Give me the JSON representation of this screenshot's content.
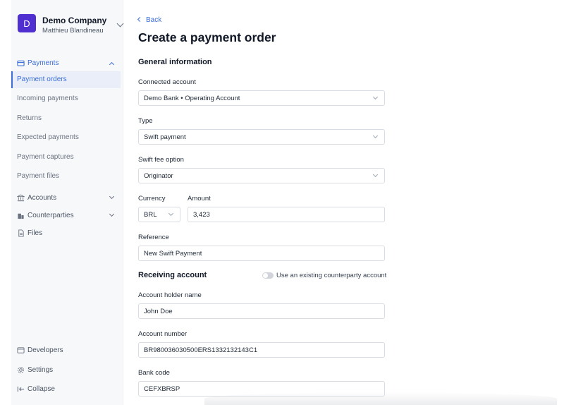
{
  "company": {
    "avatar_letter": "D",
    "name": "Demo Company",
    "user": "Matthieu Blandineau"
  },
  "sidebar": {
    "payments_group": "Payments",
    "payment_items": [
      "Payment orders",
      "Incoming payments",
      "Returns",
      "Expected payments",
      "Payment captures",
      "Payment files"
    ],
    "accounts": "Accounts",
    "counterparties": "Counterparties",
    "files": "Files",
    "developers": "Developers",
    "settings": "Settings",
    "collapse": "Collapse"
  },
  "main": {
    "back": "Back",
    "title": "Create a payment order",
    "general_section": "General information",
    "connected_account_label": "Connected account",
    "connected_account_value": "Demo Bank • Operating Account",
    "type_label": "Type",
    "type_value": "Swift payment",
    "swift_fee_label": "Swift fee option",
    "swift_fee_value": "Originator",
    "currency_label": "Currency",
    "currency_value": "BRL",
    "amount_label": "Amount",
    "amount_value": "3,423",
    "reference_label": "Reference",
    "reference_value": "New Swift Payment",
    "receiving_section": "Receiving account",
    "toggle_label": "Use an existing counterparty account",
    "toggle_on": false,
    "holder_label": "Account holder name",
    "holder_value": "John Doe",
    "account_number_label": "Account number",
    "account_number_value": "BR980036030500ERS1332132143C1",
    "bank_code_label": "Bank code",
    "bank_code_value": "CEFXBRSP"
  },
  "colors": {
    "accent": "#3b6ed8",
    "avatar": "#4f2fd0",
    "sidebar_bg": "#f7f8fa"
  }
}
